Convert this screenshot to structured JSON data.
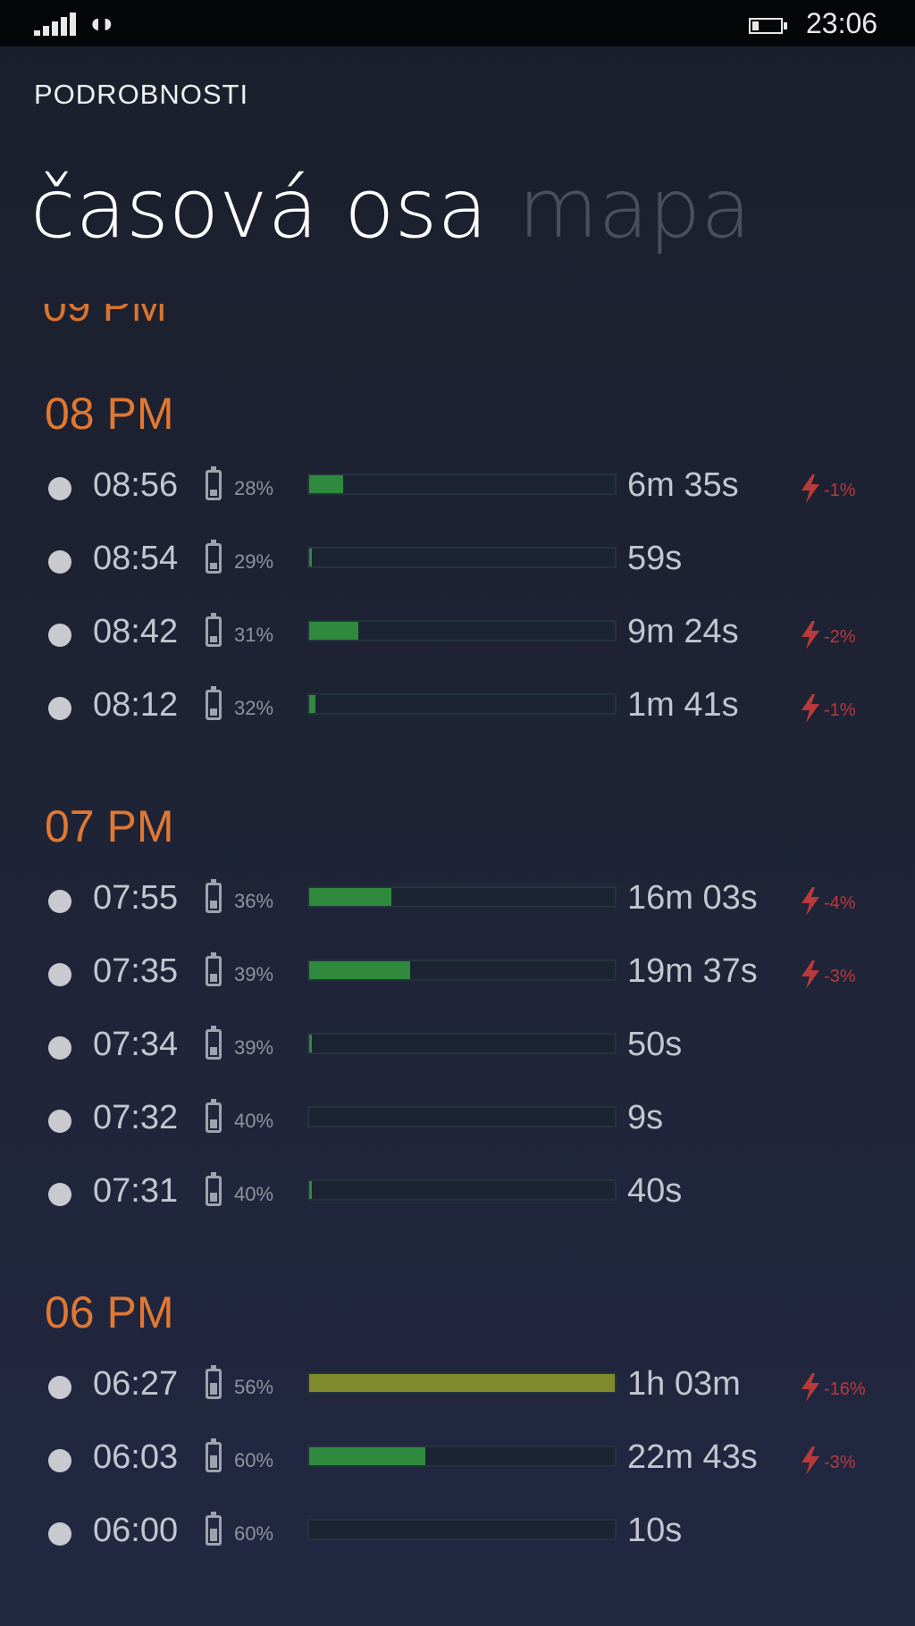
{
  "status_bar": {
    "signal_icon": "signal-bars-icon",
    "wifi_icon": "wifi-icon",
    "battery_icon": "battery-icon",
    "clock": "23:06"
  },
  "header": {
    "app_title": "PODROBNOSTI",
    "tabs": [
      {
        "label": "časová osa",
        "active": true
      },
      {
        "label": "mapa",
        "active": false
      }
    ],
    "cutoff_header": "09 PM"
  },
  "colors": {
    "accent_orange": "#e07832",
    "bar_green": "#2f8a3d",
    "bar_olive": "#7f8a2c",
    "drain_red": "#b93a3a"
  },
  "groups": [
    {
      "header": "08 PM",
      "entries": [
        {
          "time": "08:56",
          "battery": "28%",
          "bar_fraction": 0.11,
          "bar_color": "green",
          "duration": "6m 35s",
          "drain": "-1%"
        },
        {
          "time": "08:54",
          "battery": "29%",
          "bar_fraction": 0.01,
          "bar_color": "green",
          "duration": "59s",
          "drain": ""
        },
        {
          "time": "08:42",
          "battery": "31%",
          "bar_fraction": 0.16,
          "bar_color": "green",
          "duration": "9m 24s",
          "drain": "-2%"
        },
        {
          "time": "08:12",
          "battery": "32%",
          "bar_fraction": 0.02,
          "bar_color": "green",
          "duration": "1m 41s",
          "drain": "-1%"
        }
      ]
    },
    {
      "header": "07 PM",
      "entries": [
        {
          "time": "07:55",
          "battery": "36%",
          "bar_fraction": 0.27,
          "bar_color": "green",
          "duration": "16m 03s",
          "drain": "-4%"
        },
        {
          "time": "07:35",
          "battery": "39%",
          "bar_fraction": 0.33,
          "bar_color": "green",
          "duration": "19m 37s",
          "drain": "-3%"
        },
        {
          "time": "07:34",
          "battery": "39%",
          "bar_fraction": 0.01,
          "bar_color": "green",
          "duration": "50s",
          "drain": ""
        },
        {
          "time": "07:32",
          "battery": "40%",
          "bar_fraction": 0.0,
          "bar_color": "green",
          "duration": "9s",
          "drain": ""
        },
        {
          "time": "07:31",
          "battery": "40%",
          "bar_fraction": 0.01,
          "bar_color": "green",
          "duration": "40s",
          "drain": ""
        }
      ]
    },
    {
      "header": "06 PM",
      "entries": [
        {
          "time": "06:27",
          "battery": "56%",
          "bar_fraction": 1.0,
          "bar_color": "olive",
          "duration": "1h 03m",
          "drain": "-16%"
        },
        {
          "time": "06:03",
          "battery": "60%",
          "bar_fraction": 0.38,
          "bar_color": "green",
          "duration": "22m 43s",
          "drain": "-3%"
        },
        {
          "time": "06:00",
          "battery": "60%",
          "bar_fraction": 0.0,
          "bar_color": "green",
          "duration": "10s",
          "drain": ""
        }
      ]
    }
  ]
}
